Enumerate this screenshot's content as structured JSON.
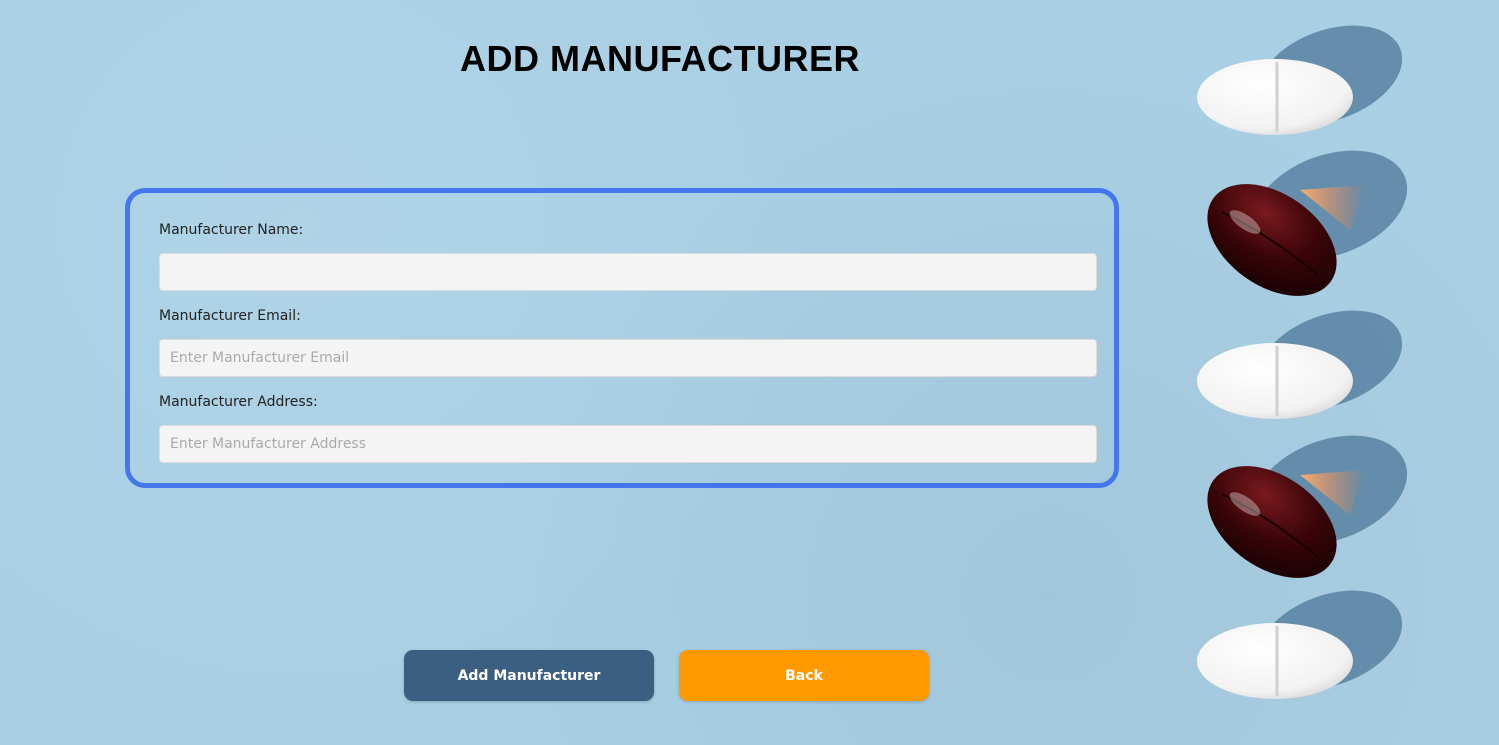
{
  "header": {
    "title": "ADD MANUFACTURER"
  },
  "form": {
    "name": {
      "label": "Manufacturer Name:",
      "value": "",
      "placeholder": ""
    },
    "email": {
      "label": "Manufacturer Email:",
      "value": "",
      "placeholder": "Enter Manufacturer Email"
    },
    "address": {
      "label": "Manufacturer Address:",
      "value": "",
      "placeholder": "Enter Manufacturer Address"
    }
  },
  "actions": {
    "add_label": "Add Manufacturer",
    "back_label": "Back"
  },
  "colors": {
    "background": "#a9cfe4",
    "panel_border": "#4477ee",
    "add_button": "#3a5f80",
    "back_button": "#ff9900"
  }
}
